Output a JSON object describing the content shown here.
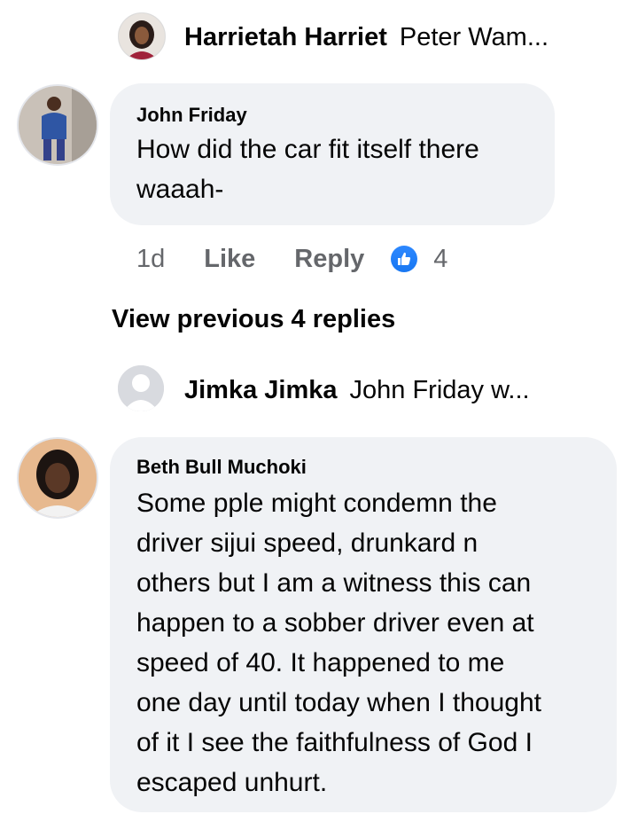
{
  "reply_preview_1": {
    "name": "Harrietah Harriet",
    "snippet": "Peter Wam..."
  },
  "comment_1": {
    "author": "John Friday",
    "lines": [
      "How did the car fit itself there",
      "waaah-"
    ],
    "time": "1d",
    "like_label": "Like",
    "reply_label": "Reply",
    "reaction_count": "4",
    "reaction_icon": "thumbs-up-icon",
    "reaction_color": "#1877f2"
  },
  "view_previous": "View previous 4 replies",
  "reply_preview_2": {
    "name": "Jimka Jimka",
    "snippet": "John Friday w..."
  },
  "comment_2": {
    "author": "Beth Bull Muchoki",
    "lines": [
      "Some pple might condemn the",
      "driver sijui speed, drunkard n",
      "others but I am a witness this can",
      "happen to a sobber driver even at",
      "speed of 40. It happened to me",
      "one day until today when I thought",
      "of it I see the faithfulness of God I",
      "escaped unhurt."
    ]
  }
}
